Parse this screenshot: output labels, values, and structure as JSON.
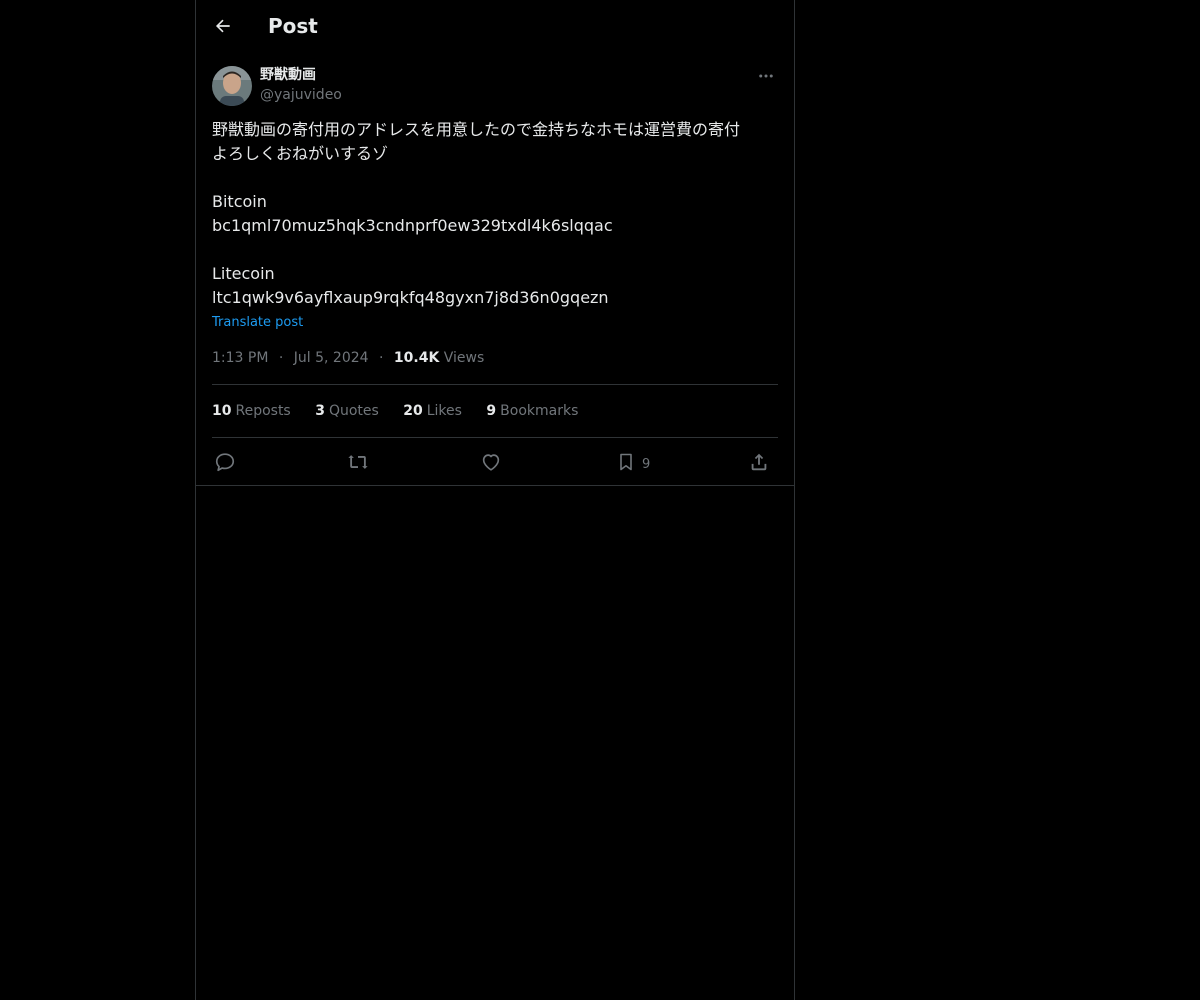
{
  "header": {
    "title": "Post",
    "back_icon": "arrow-left-icon"
  },
  "author": {
    "name": "野獣動画",
    "handle": "@yajuvideo"
  },
  "post": {
    "text_line1": "野獣動画の寄付用のアドレスを用意したので金持ちなホモは運営費の寄付",
    "text_line2": "よろしくおねがいするゾ",
    "bitcoin_label": "Bitcoin",
    "bitcoin_address": "bc1qml70muz5hqk3cndnprf0ew329txdl4k6slqqac",
    "litecoin_label": "Litecoin",
    "litecoin_address": "ltc1qwk9v6ayflxaup9rqkfq48gyxn7j8d36n0gqezn",
    "translate_label": "Translate post"
  },
  "meta": {
    "time": "1:13 PM",
    "date": "Jul 5, 2024",
    "views_count": "10.4K",
    "views_label": "Views",
    "separator": "·"
  },
  "stats": {
    "reposts_count": "10",
    "reposts_label": "Reposts",
    "quotes_count": "3",
    "quotes_label": "Quotes",
    "likes_count": "20",
    "likes_label": "Likes",
    "bookmarks_count": "9",
    "bookmarks_label": "Bookmarks"
  },
  "actions": {
    "reply_icon": "reply-icon",
    "repost_icon": "repost-icon",
    "like_icon": "heart-icon",
    "bookmark_icon": "bookmark-icon",
    "bookmark_count": "9",
    "share_icon": "share-icon"
  },
  "colors": {
    "background": "#000000",
    "text_primary": "#e7e9ea",
    "text_secondary": "#71767b",
    "link": "#1d9bf0",
    "border": "#2f3336"
  }
}
